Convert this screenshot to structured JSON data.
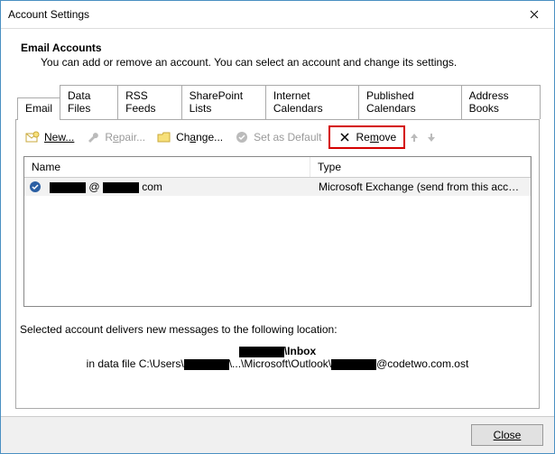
{
  "window": {
    "title": "Account Settings"
  },
  "header": {
    "heading": "Email Accounts",
    "sub": "You can add or remove an account. You can select an account and change its settings."
  },
  "tabs": {
    "items": [
      {
        "label": "Email"
      },
      {
        "label": "Data Files"
      },
      {
        "label": "RSS Feeds"
      },
      {
        "label": "SharePoint Lists"
      },
      {
        "label": "Internet Calendars"
      },
      {
        "label": "Published Calendars"
      },
      {
        "label": "Address Books"
      }
    ]
  },
  "toolbar": {
    "new": "New...",
    "repair_pre": "R",
    "repair_u": "e",
    "repair_post": "pair...",
    "change_pre": "Ch",
    "change_u": "a",
    "change_post": "nge...",
    "default": "Set as Default",
    "remove_pre": "Re",
    "remove_u": "m",
    "remove_post": "ove"
  },
  "list": {
    "col_name": "Name",
    "col_type": "Type",
    "rows": [
      {
        "name_part1": "@",
        "name_part2": "com",
        "type": "Microsoft Exchange (send from this account by def..."
      }
    ]
  },
  "delivery": {
    "line1": "Selected account delivers new messages to the following location:",
    "folder": "\\Inbox",
    "path_pre": "in data file C:\\Users\\",
    "path_mid": "\\...\\Microsoft\\Outlook\\",
    "path_post": "@codetwo.com.ost"
  },
  "footer": {
    "close": "Close"
  }
}
